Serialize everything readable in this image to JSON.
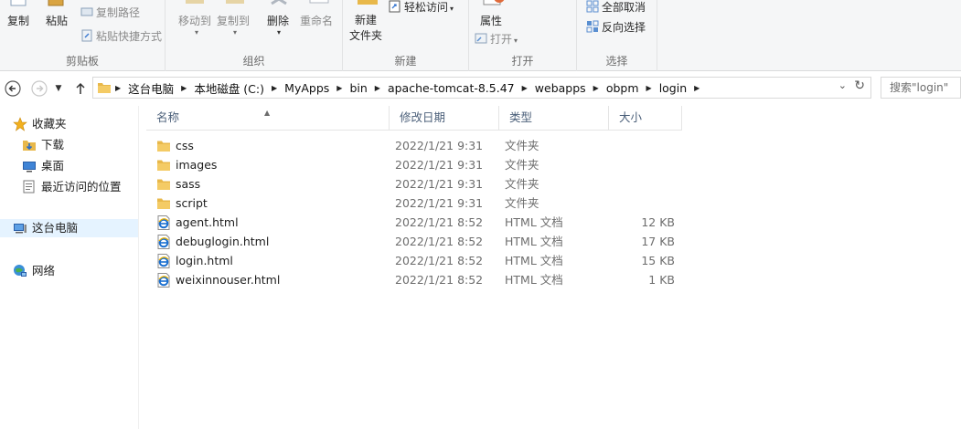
{
  "ribbon": {
    "clipboard": {
      "copy": "复制",
      "paste": "粘贴",
      "copy_path": "复制路径",
      "paste_shortcut": "粘贴快捷方式",
      "label": "剪贴板"
    },
    "organize": {
      "move_to": "移动到",
      "copy_to": "复制到",
      "delete": "删除",
      "rename": "重命名",
      "label": "组织"
    },
    "new": {
      "new_folder_line1": "新建",
      "new_folder_line2": "文件夹",
      "easy_access": "轻松访问",
      "label": "新建"
    },
    "open": {
      "properties": "属性",
      "open": "打开",
      "label": "打开"
    },
    "select": {
      "select_none": "全部取消",
      "invert_selection": "反向选择",
      "label": "选择"
    }
  },
  "address": {
    "crumbs": [
      "这台电脑",
      "本地磁盘 (C:)",
      "MyApps",
      "bin",
      "apache-tomcat-8.5.47",
      "webapps",
      "obpm",
      "login"
    ],
    "search_placeholder": "搜索\"login\""
  },
  "sidebar": {
    "favorites": "收藏夹",
    "downloads": "下载",
    "desktop": "桌面",
    "recent": "最近访问的位置",
    "this_pc": "这台电脑",
    "network": "网络"
  },
  "columns": {
    "name": "名称",
    "modified": "修改日期",
    "type": "类型",
    "size": "大小"
  },
  "files": [
    {
      "name": "css",
      "modified": "2022/1/21 9:31",
      "type": "文件夹",
      "size": "",
      "kind": "folder"
    },
    {
      "name": "images",
      "modified": "2022/1/21 9:31",
      "type": "文件夹",
      "size": "",
      "kind": "folder"
    },
    {
      "name": "sass",
      "modified": "2022/1/21 9:31",
      "type": "文件夹",
      "size": "",
      "kind": "folder"
    },
    {
      "name": "script",
      "modified": "2022/1/21 9:31",
      "type": "文件夹",
      "size": "",
      "kind": "folder"
    },
    {
      "name": "agent.html",
      "modified": "2022/1/21 8:52",
      "type": "HTML 文档",
      "size": "12 KB",
      "kind": "html"
    },
    {
      "name": "debuglogin.html",
      "modified": "2022/1/21 8:52",
      "type": "HTML 文档",
      "size": "17 KB",
      "kind": "html"
    },
    {
      "name": "login.html",
      "modified": "2022/1/21 8:52",
      "type": "HTML 文档",
      "size": "15 KB",
      "kind": "html"
    },
    {
      "name": "weixinnouser.html",
      "modified": "2022/1/21 8:52",
      "type": "HTML 文档",
      "size": "1 KB",
      "kind": "html"
    }
  ],
  "colors": {
    "folder": "#e8b84a",
    "ie_blue": "#1a6fd0",
    "header_text": "#4c607a",
    "selected_nav": "#e5f3ff"
  }
}
